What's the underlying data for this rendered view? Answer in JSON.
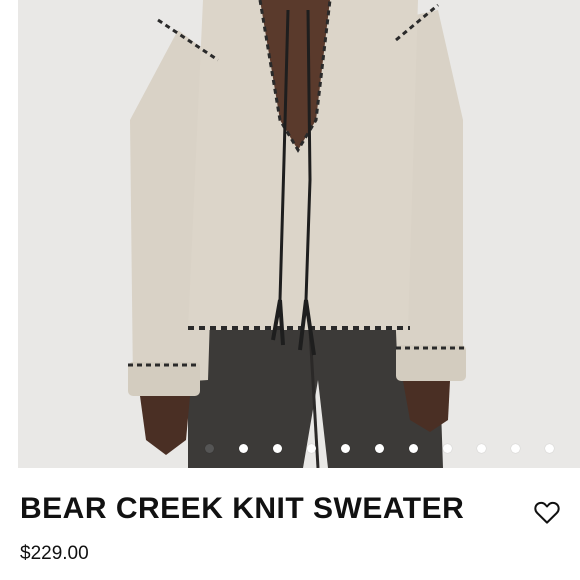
{
  "product": {
    "title": "BEAR CREEK KNIT SWEATER",
    "price": "$229.00",
    "image_alt": "Cream knit sweater with black whipstitch trim and leather tie worn with dark jeans"
  },
  "gallery": {
    "total_images": 11,
    "active_index": 0
  },
  "icons": {
    "favorite": "heart-outline-icon"
  },
  "colors": {
    "sweater": "#d9d2c6",
    "stitch": "#2a2a2a",
    "jeans": "#3c3a38",
    "background": "#e9e8e6"
  }
}
